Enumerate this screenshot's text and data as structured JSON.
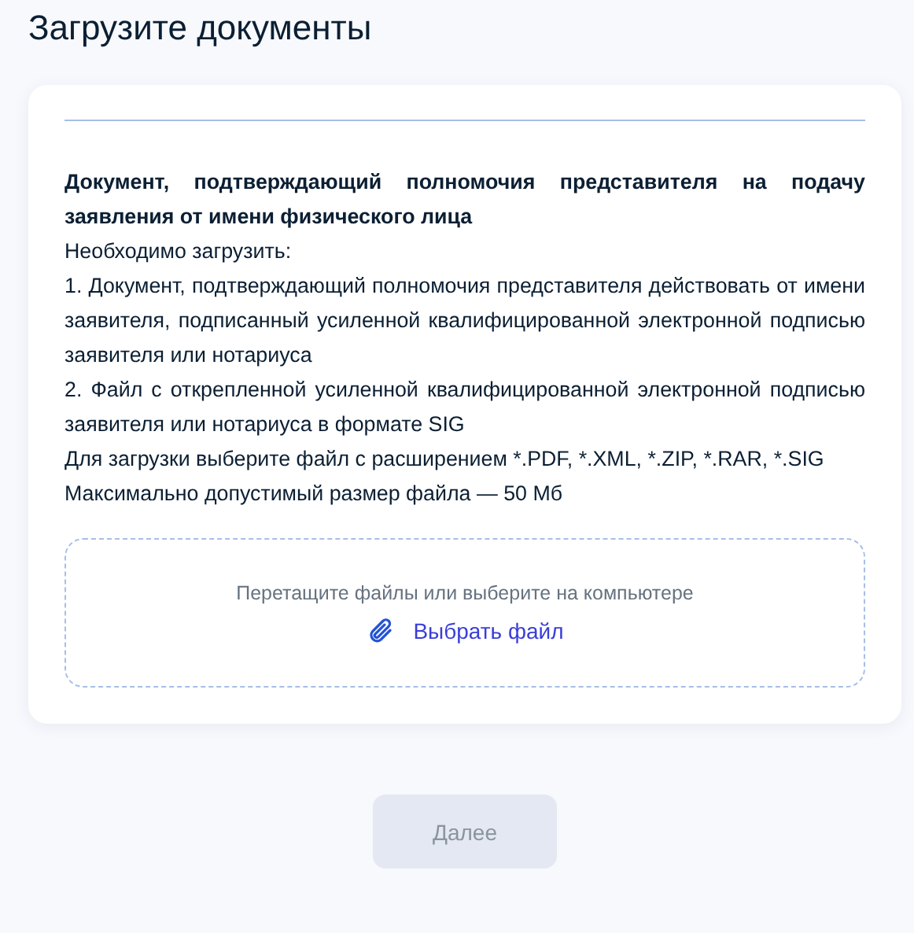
{
  "title": "Загрузите документы",
  "document": {
    "heading": "Документ, подтверждающий полномочия представителя на подачу заявления от имени физического лица",
    "paragraphs": [
      "Необходимо загрузить:",
      "1. Документ, подтверждающий полномочия представителя действовать от имени заявителя, подписанный усиленной квалифицированной электронной подписью заявителя или нотариуса",
      "2. Файл с открепленной усиленной квалифицированной электронной подписью заявителя или нотариуса в формате SIG",
      "Для загрузки выберите файл с расширением *.PDF, *.XML, *.ZIP, *.RAR, *.SIG",
      "Максимально допустимый размер файла — 50 Мб"
    ]
  },
  "dropzone": {
    "hint": "Перетащите файлы или выберите на компьютере",
    "link": "Выбрать файл"
  },
  "next_button": {
    "label": "Далее",
    "disabled": true
  }
}
